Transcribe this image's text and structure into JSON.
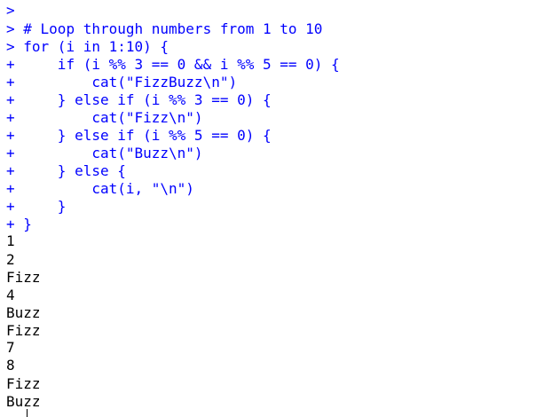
{
  "console": {
    "lines": [
      {
        "prompt": ">",
        "code": ""
      },
      {
        "prompt": ">",
        "code": " # Loop through numbers from 1 to 10"
      },
      {
        "prompt": ">",
        "code": " for (i in 1:10) {"
      },
      {
        "prompt": "+",
        "code": "     if (i %% 3 == 0 && i %% 5 == 0) {"
      },
      {
        "prompt": "+",
        "code": "         cat(\"FizzBuzz\\n\")"
      },
      {
        "prompt": "+",
        "code": "     } else if (i %% 3 == 0) {"
      },
      {
        "prompt": "+",
        "code": "         cat(\"Fizz\\n\")"
      },
      {
        "prompt": "+",
        "code": "     } else if (i %% 5 == 0) {"
      },
      {
        "prompt": "+",
        "code": "         cat(\"Buzz\\n\")"
      },
      {
        "prompt": "+",
        "code": "     } else {"
      },
      {
        "prompt": "+",
        "code": "         cat(i, \"\\n\")"
      },
      {
        "prompt": "+",
        "code": "     }"
      },
      {
        "prompt": "+",
        "code": " }"
      }
    ],
    "output": [
      "1",
      "2",
      "Fizz",
      "4",
      "Buzz",
      "Fizz",
      "7",
      "8",
      "Fizz",
      "Buzz"
    ]
  },
  "colors": {
    "input_text": "#0000ff",
    "output_text": "#000000",
    "background": "#ffffff"
  }
}
